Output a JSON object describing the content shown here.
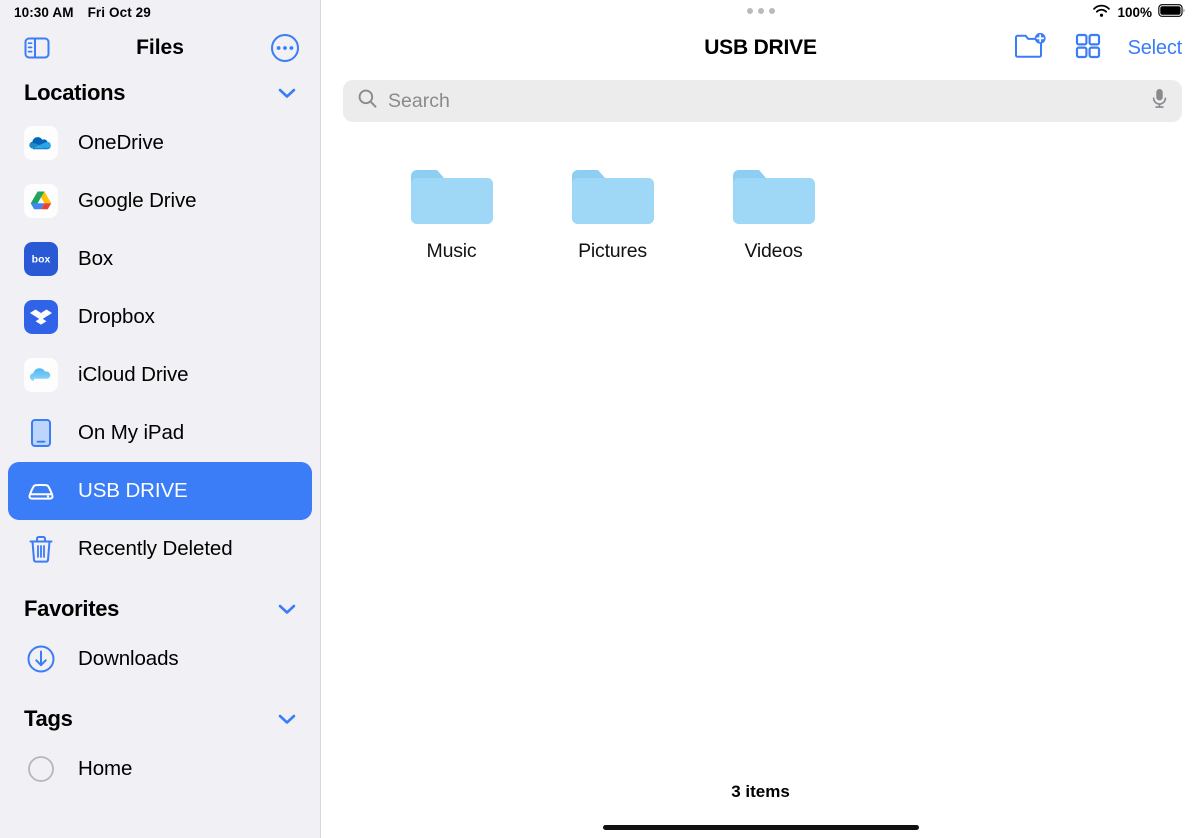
{
  "status_bar": {
    "time": "10:30 AM",
    "date": "Fri Oct 29",
    "battery_percent": "100%",
    "wifi_icon": "wifi-icon",
    "battery_icon": "battery-full-icon"
  },
  "sidebar": {
    "title": "Files",
    "toggle_icon": "sidebar-toggle-icon",
    "more_icon": "ellipsis-circle-icon",
    "sections": [
      {
        "id": "locations",
        "title": "Locations",
        "chevron_icon": "chevron-down-icon",
        "items": [
          {
            "label": "OneDrive",
            "icon": "onedrive-icon",
            "selected": false
          },
          {
            "label": "Google Drive",
            "icon": "google-drive-icon",
            "selected": false
          },
          {
            "label": "Box",
            "icon": "box-icon",
            "selected": false
          },
          {
            "label": "Dropbox",
            "icon": "dropbox-icon",
            "selected": false
          },
          {
            "label": "iCloud Drive",
            "icon": "icloud-drive-icon",
            "selected": false
          },
          {
            "label": "On My iPad",
            "icon": "ipad-icon",
            "selected": false
          },
          {
            "label": "USB DRIVE",
            "icon": "external-drive-icon",
            "selected": true
          },
          {
            "label": "Recently Deleted",
            "icon": "trash-icon",
            "selected": false
          }
        ]
      },
      {
        "id": "favorites",
        "title": "Favorites",
        "chevron_icon": "chevron-down-icon",
        "items": [
          {
            "label": "Downloads",
            "icon": "download-circle-icon",
            "selected": false
          }
        ]
      },
      {
        "id": "tags",
        "title": "Tags",
        "chevron_icon": "chevron-down-icon",
        "items": [
          {
            "label": "Home",
            "icon": "tag-circle-icon",
            "selected": false
          }
        ]
      }
    ]
  },
  "main": {
    "title": "USB DRIVE",
    "multitask_dots": "multitasking-dots",
    "actions": {
      "new_folder_icon": "new-folder-icon",
      "view_grid_icon": "grid-view-icon",
      "select_label": "Select"
    },
    "search": {
      "placeholder": "Search",
      "search_icon": "search-icon",
      "dictate_icon": "microphone-icon"
    },
    "files": [
      {
        "name": "Music",
        "icon": "folder-icon"
      },
      {
        "name": "Pictures",
        "icon": "folder-icon"
      },
      {
        "name": "Videos",
        "icon": "folder-icon"
      }
    ],
    "item_count": "3 items"
  },
  "colors": {
    "accent_blue": "#3b7cf7",
    "sidebar_bg": "#f1f1f5",
    "folder_blue": "#9ed5f5",
    "search_bg": "#ececec"
  }
}
